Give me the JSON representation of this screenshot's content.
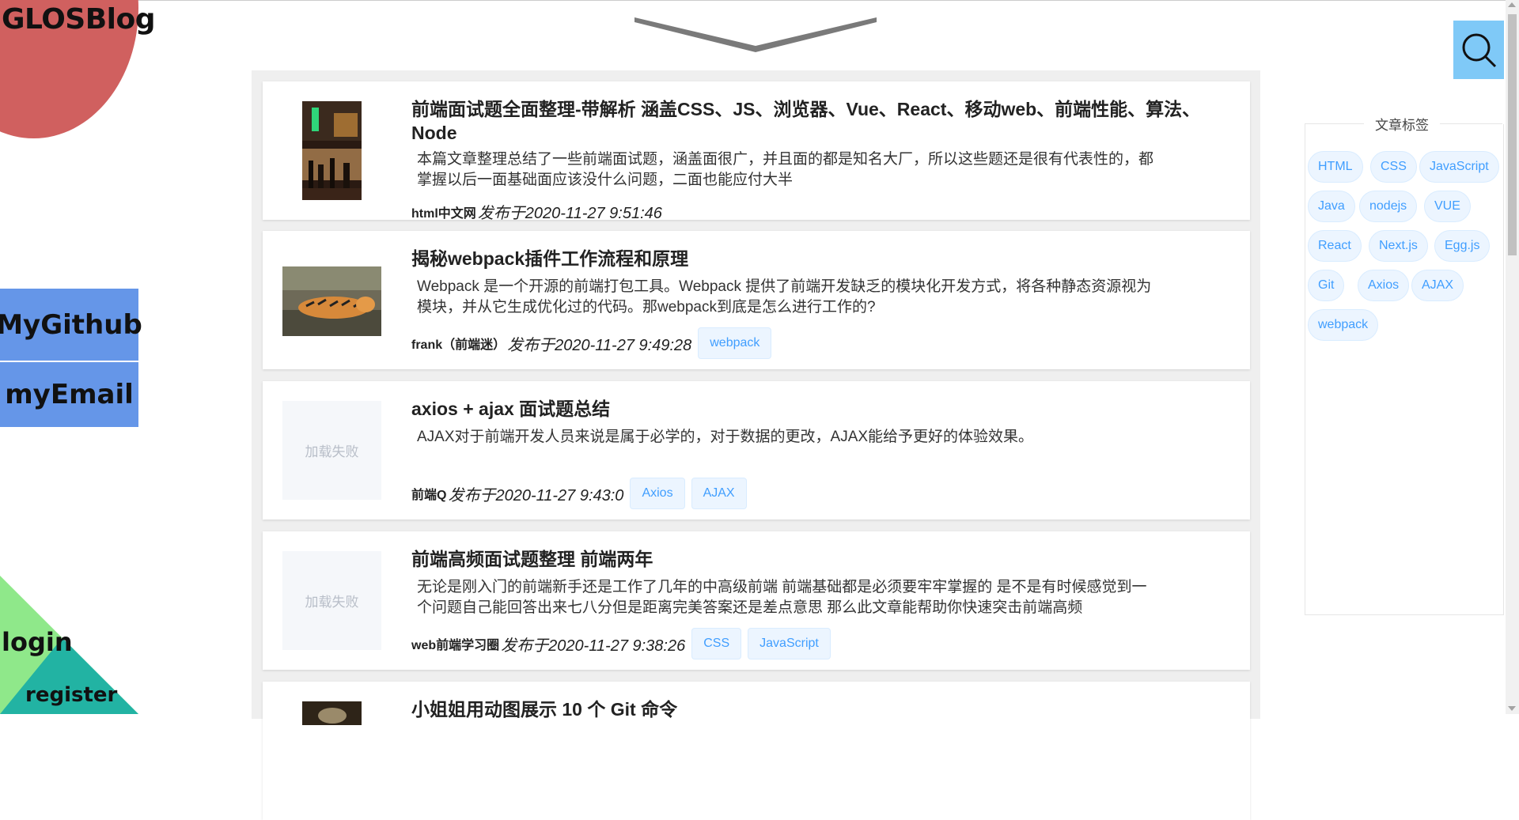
{
  "brand": "GLOSBlog",
  "nav": {
    "github": "MyGithub",
    "email": "myEmail",
    "login": "login",
    "register": "register"
  },
  "posts": [
    {
      "title": "前端面试题全面整理-带解析 涵盖CSS、JS、浏览器、Vue、React、移动web、前端性能、算法、Node",
      "desc": "本篇文章整理总结了一些前端面试题，涵盖面很广，并且面的都是知名大厂，所以这些题还是很有代表性的，都掌握以后一面基础面应该没什么问题，二面也能应付大半",
      "author": "html中文网",
      "date": "发布于2020-11-27 9:51:46",
      "tags": [],
      "image": "night-street-photo"
    },
    {
      "title": "揭秘webpack插件工作流程和原理",
      "desc": "Webpack 是一个开源的前端打包工具。Webpack 提供了前端开发缺乏的模块化开发方式，将各种静态资源视为模块，并从它生成优化过的代码。那webpack到底是怎么进行工作的?",
      "author": "frank（前端迷）",
      "date": "发布于2020-11-27 9:49:28",
      "tags": [
        "webpack"
      ],
      "image": "tiger-photo"
    },
    {
      "title": "axios + ajax 面试题总结",
      "desc": "AJAX对于前端开发人员来说是属于必学的，对于数据的更改，AJAX能给予更好的体验效果。",
      "author": "前端Q",
      "date": "发布于2020-11-27 9:43:0",
      "tags": [
        "Axios",
        "AJAX"
      ],
      "image_failed": "加载失败"
    },
    {
      "title": "前端高频面试题整理 前端两年",
      "desc": "无论是刚入门的前端新手还是工作了几年的中高级前端 前端基础都是必须要牢牢掌握的 是不是有时候感觉到一个问题自己能回答出来七八分但是距离完美答案还是差点意思 那么此文章能帮助你快速突击前端高频",
      "author": "web前端学习圈",
      "date": "发布于2020-11-27 9:38:26",
      "tags": [
        "CSS",
        "JavaScript"
      ],
      "image_failed": "加载失败"
    },
    {
      "title": "小姐姐用动图展示 10 个 Git 命令"
    }
  ],
  "sidebar": {
    "legend": "文章标签",
    "tags": [
      "HTML",
      "CSS",
      "JavaScript",
      "Java",
      "nodejs",
      "VUE",
      "React",
      "Next.js",
      "Egg.js",
      "Git",
      "Axios",
      "AJAX",
      "webpack"
    ]
  },
  "icons": {
    "search": "search-icon",
    "chevron": "chevron-down-icon"
  }
}
